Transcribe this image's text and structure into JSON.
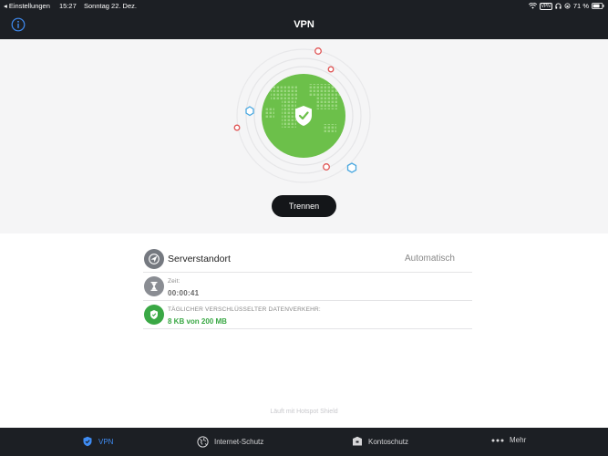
{
  "status_bar": {
    "back_label": "◂ Einstellungen",
    "time": "15:27",
    "date": "Sonntag 22. Dez.",
    "vpn_badge": "VPN",
    "battery": "71 %"
  },
  "nav": {
    "title": "VPN",
    "info_icon": "info-icon"
  },
  "hero": {
    "status_icon": "shield-check-icon",
    "disconnect_label": "Trennen",
    "colors": {
      "globe": "#6cc04a",
      "red_dot": "#e05555",
      "blue_hex": "#4aa8e0"
    }
  },
  "info": {
    "server": {
      "label": "Serverstandort",
      "value": "Automatisch",
      "icon": "location-icon"
    },
    "time": {
      "label": "Zeit:",
      "value": "00:00:41",
      "icon": "hourglass-icon"
    },
    "traffic": {
      "label": "TÄGLICHER VERSCHLÜSSELTER DATENVERKEHR:",
      "value": "8 KB von 200 MB",
      "icon": "shield-icon"
    }
  },
  "footer_note": "Läuft mit Hotspot Shield",
  "tabs": [
    {
      "label": "VPN",
      "icon": "shield-icon",
      "active": true
    },
    {
      "label": "Internet-Schutz",
      "icon": "globe-icon",
      "active": false
    },
    {
      "label": "Kontoschutz",
      "icon": "mailbox-icon",
      "active": false
    },
    {
      "label": "Mehr",
      "icon": "more-dots-icon",
      "active": false
    }
  ]
}
